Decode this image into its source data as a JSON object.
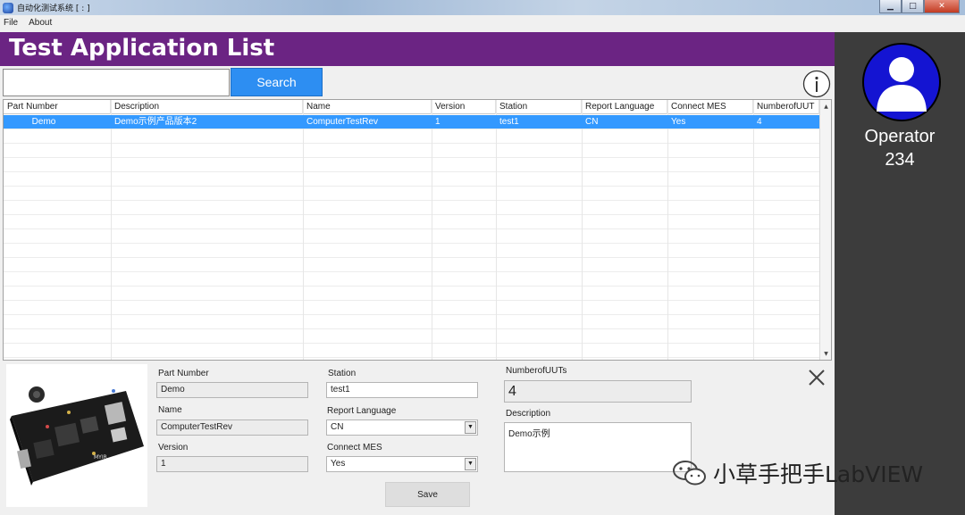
{
  "window": {
    "title": "自动化测试系统 [ : ]",
    "controls": {
      "minimize": "▁",
      "maximize": "□",
      "close": "✕"
    }
  },
  "menu": {
    "items": [
      "File",
      "About"
    ]
  },
  "header": {
    "title": "Test Application List"
  },
  "search": {
    "value": "",
    "placeholder": "",
    "button_label": "Search"
  },
  "table": {
    "columns": [
      "Part Number",
      "Description",
      "Name",
      "Version",
      "Station",
      "Report Language",
      "Connect MES",
      "NumberofUUT"
    ],
    "rows": [
      {
        "part_number": "Demo",
        "description": "Demo示例产品版本2",
        "name": "ComputerTestRev",
        "version": "1",
        "station": "test1",
        "report_language": "CN",
        "connect_mes": "Yes",
        "number_of_uut": "4"
      }
    ],
    "selected_row": 0,
    "scroll": {
      "up": "▲",
      "down": "▼"
    }
  },
  "detail": {
    "part_number": {
      "label": "Part Number",
      "value": "Demo"
    },
    "name": {
      "label": "Name",
      "value": "ComputerTestRev"
    },
    "version": {
      "label": "Version",
      "value": "1"
    },
    "station": {
      "label": "Station",
      "value": "test1"
    },
    "report_language": {
      "label": "Report Language",
      "value": "CN"
    },
    "connect_mes": {
      "label": "Connect MES",
      "value": "Yes"
    },
    "number_of_uuts": {
      "label": "NumberofUUTs",
      "value": "4"
    },
    "description": {
      "label": "Description",
      "value": "Demo示例"
    },
    "save_label": "Save",
    "dropdown_arrow": "▼"
  },
  "operator": {
    "label": "Operator",
    "id": "234"
  },
  "watermark": {
    "text": "小草手把手LabVIEW"
  },
  "colors": {
    "header_purple": "#6b2483",
    "search_blue": "#2d8ef2",
    "selection_blue": "#3399ff",
    "side_panel": "#3c3c3c",
    "avatar_blue": "#1414d2"
  }
}
